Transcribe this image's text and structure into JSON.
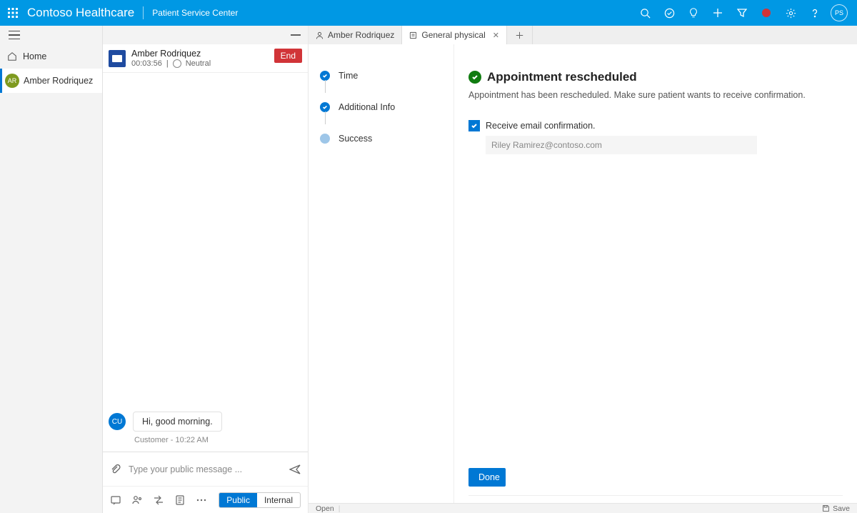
{
  "topbar": {
    "brand": "Contoso Healthcare",
    "area": "Patient Service Center",
    "user_initials": "PS"
  },
  "sidebar": {
    "home_label": "Home",
    "patient": {
      "initials": "AR",
      "name": "Amber Rodriquez"
    }
  },
  "chat": {
    "name": "Amber Rodriquez",
    "duration": "00:03:56",
    "sentiment": "Neutral",
    "end_label": "End",
    "cu_badge": "CU",
    "message": "Hi, good morning.",
    "message_meta": "Customer - 10:22 AM",
    "input_placeholder": "Type your public message ...",
    "seg_public": "Public",
    "seg_internal": "Internal"
  },
  "tabs": {
    "person": "Amber Rodriquez",
    "record": "General physical"
  },
  "steps": {
    "s1": "Time",
    "s2": "Additional Info",
    "s3": "Success"
  },
  "main": {
    "heading": "Appointment rescheduled",
    "subtext": "Appointment has been rescheduled. Make sure patient wants to receive confirmation.",
    "checkbox_label": "Receive email confirmation.",
    "email": "Riley Ramirez@contoso.com",
    "done_label": "Done"
  },
  "footer": {
    "open": "Open",
    "save": "Save"
  }
}
